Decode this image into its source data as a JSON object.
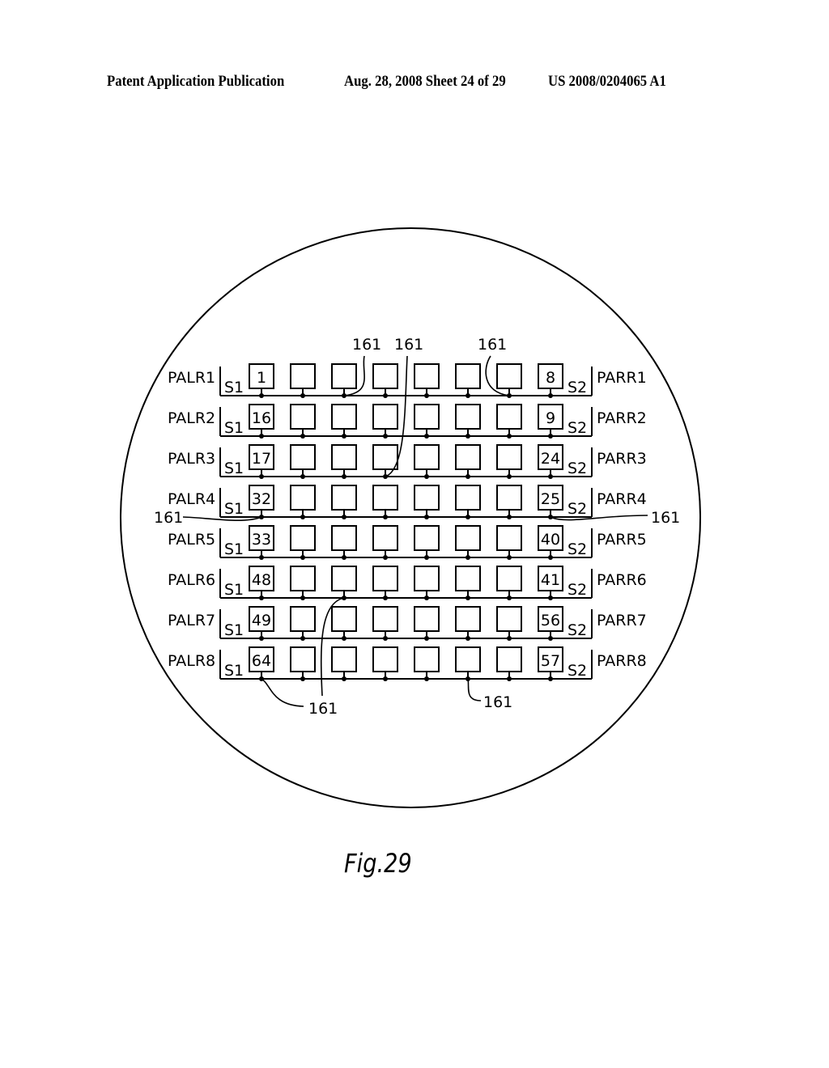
{
  "header": {
    "publication": "Patent Application Publication",
    "date_sheet": "Aug. 28, 2008  Sheet 24 of 29",
    "patent_number": "US 2008/0204065 A1"
  },
  "figure": {
    "caption": "Fig.29",
    "columns": 8,
    "rows": [
      {
        "left_label": "PALR1",
        "right_label": "PARR1",
        "first": "1",
        "last": "8"
      },
      {
        "left_label": "PALR2",
        "right_label": "PARR2",
        "first": "16",
        "last": "9"
      },
      {
        "left_label": "PALR3",
        "right_label": "PARR3",
        "first": "17",
        "last": "24"
      },
      {
        "left_label": "PALR4",
        "right_label": "PARR4",
        "first": "32",
        "last": "25"
      },
      {
        "left_label": "PALR5",
        "right_label": "PARR5",
        "first": "33",
        "last": "40"
      },
      {
        "left_label": "PALR6",
        "right_label": "PARR6",
        "first": "48",
        "last": "41"
      },
      {
        "left_label": "PALR7",
        "right_label": "PARR7",
        "first": "49",
        "last": "56"
      },
      {
        "left_label": "PALR8",
        "right_label": "PARR8",
        "first": "64",
        "last": "57"
      }
    ],
    "left_switch_label": "S1",
    "right_switch_label": "S2",
    "reference_label": "161"
  }
}
